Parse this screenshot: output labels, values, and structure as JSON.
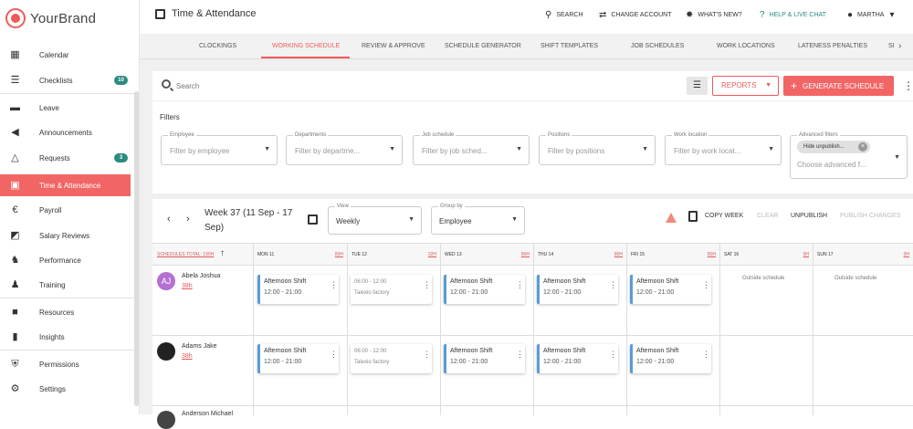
{
  "brand": {
    "name": "YourBrand"
  },
  "sidebar": {
    "items": [
      {
        "label": "Calendar",
        "badge": ""
      },
      {
        "label": "Checklists",
        "badge": "10"
      },
      {
        "label": "Leave",
        "badge": ""
      },
      {
        "label": "Announcements",
        "badge": ""
      },
      {
        "label": "Requests",
        "badge": "3"
      },
      {
        "label": "Time & Attendance",
        "badge": ""
      },
      {
        "label": "Payroll",
        "badge": ""
      },
      {
        "label": "Salary Reviews",
        "badge": ""
      },
      {
        "label": "Performance",
        "badge": ""
      },
      {
        "label": "Training",
        "badge": ""
      },
      {
        "label": "Resources",
        "badge": ""
      },
      {
        "label": "Insights",
        "badge": ""
      },
      {
        "label": "Permissions",
        "badge": ""
      },
      {
        "label": "Settings",
        "badge": ""
      }
    ]
  },
  "header": {
    "title": "Time & Attendance",
    "actions": {
      "search": "SEARCH",
      "change_account": "CHANGE ACCOUNT",
      "whats_new": "WHAT'S NEW?",
      "help": "HELP & LIVE CHAT",
      "user": "MARTHA"
    }
  },
  "tabs": [
    "CLOCKINGS",
    "WORKING SCHEDULE",
    "REVIEW & APPROVE",
    "SCHEDULE GENERATOR",
    "SHIFT TEMPLATES",
    "JOB SCHEDULES",
    "WORK LOCATIONS",
    "LATENESS PENALTIES",
    "SI"
  ],
  "toolbar": {
    "search_placeholder": "Search",
    "reports": "REPORTS",
    "generate": "GENERATE SCHEDULE"
  },
  "filters": {
    "heading": "Filters",
    "fields": [
      {
        "label": "Employee",
        "placeholder": "Filter by employee"
      },
      {
        "label": "Departments",
        "placeholder": "Filter by departme..."
      },
      {
        "label": "Job schedule",
        "placeholder": "Filter by job sched..."
      },
      {
        "label": "Positions",
        "placeholder": "Filter by positions"
      },
      {
        "label": "Work location",
        "placeholder": "Filter by work locat..."
      }
    ],
    "advanced": {
      "label": "Advanced filters",
      "chip": "Hide unpublish...",
      "placeholder": "Choose advanced f..."
    }
  },
  "week": {
    "title": "Week 37 (11 Sep - 17 Sep)",
    "view_label": "View",
    "view_value": "Weekly",
    "group_label": "Group by",
    "group_value": "Employee",
    "copy": "COPY WEEK",
    "clear": "CLEAR",
    "unpublish": "UNPUBLISH",
    "publish": "PUBLISH CHANGES"
  },
  "grid": {
    "total": "SCHEDULES TOTAL: 190H",
    "days": [
      {
        "day": "MON 11",
        "hours": "80H"
      },
      {
        "day": "TUE 12",
        "hours": "32H"
      },
      {
        "day": "WED 13",
        "hours": "80H"
      },
      {
        "day": "THU 14",
        "hours": "80H"
      },
      {
        "day": "FRI 15",
        "hours": "80H"
      },
      {
        "day": "SAT 16",
        "hours": "0H"
      },
      {
        "day": "SUN 17",
        "hours": "0H"
      }
    ],
    "employees": [
      {
        "initials": "AJ",
        "name": "Abela Joshua",
        "hours": "38h",
        "avatar_color": "#b56fd1",
        "shifts": [
          {
            "title": "Afternoon Shift",
            "time": "12:00 - 21:00"
          },
          {
            "title": "06:00 - 12:00",
            "time": "Talexio factory"
          },
          {
            "title": "Afternoon Shift",
            "time": "12:00 - 21:00"
          },
          {
            "title": "Afternoon Shift",
            "time": "12:00 - 21:00"
          },
          {
            "title": "Afternoon Shift",
            "time": "12:00 - 21:00"
          }
        ],
        "outside": [
          "Outside schedule",
          "Outside schedule"
        ]
      },
      {
        "initials": "",
        "name": "Adams Jake",
        "hours": "38h",
        "avatar_color": "#222222",
        "shifts": [
          {
            "title": "Afternoon Shift",
            "time": "12:00 - 21:00"
          },
          {
            "title": "06:00 - 12:00",
            "time": "Talexio factory"
          },
          {
            "title": "Afternoon Shift",
            "time": "12:00 - 21:00"
          },
          {
            "title": "Afternoon Shift",
            "time": "12:00 - 21:00"
          },
          {
            "title": "Afternoon Shift",
            "time": "12:00 - 21:00"
          }
        ]
      },
      {
        "initials": "",
        "name": "Anderson Michael",
        "hours": "",
        "avatar_color": "#444444",
        "shifts": []
      }
    ]
  },
  "colors": {
    "accent": "#f26565",
    "teal": "#2b8a7e",
    "shift_bar": "#5b9bd5"
  }
}
